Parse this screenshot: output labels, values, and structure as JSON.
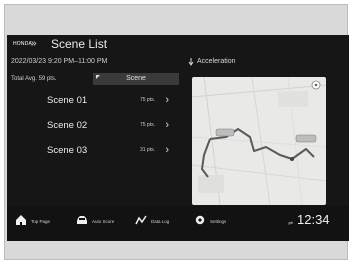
{
  "header": {
    "brand_text": "HONDA",
    "title": "Scene List",
    "chevron_glyph": "»",
    "date_range": "2022/03/23 9:20 PM–11:00 PM",
    "right_label": "Acceleration"
  },
  "summary": {
    "total": "Total Avg. 59 pts.",
    "tab_label": "Scene"
  },
  "scenes": [
    {
      "label": "Scene 01",
      "points": "75 pts."
    },
    {
      "label": "Scene 02",
      "points": "75 pts."
    },
    {
      "label": "Scene 03",
      "points": "31 pts."
    }
  ],
  "nav": {
    "top_page": "Top Page",
    "auto_score": "Auto Score",
    "data_log": "Data Log",
    "settings": "Settings"
  },
  "status": {
    "time": "12:34"
  },
  "colors": {
    "screen_bg": "#161616",
    "accent": "#3a3a3a",
    "route": "#5a5a5a",
    "map_bg": "#e9e9e7"
  }
}
